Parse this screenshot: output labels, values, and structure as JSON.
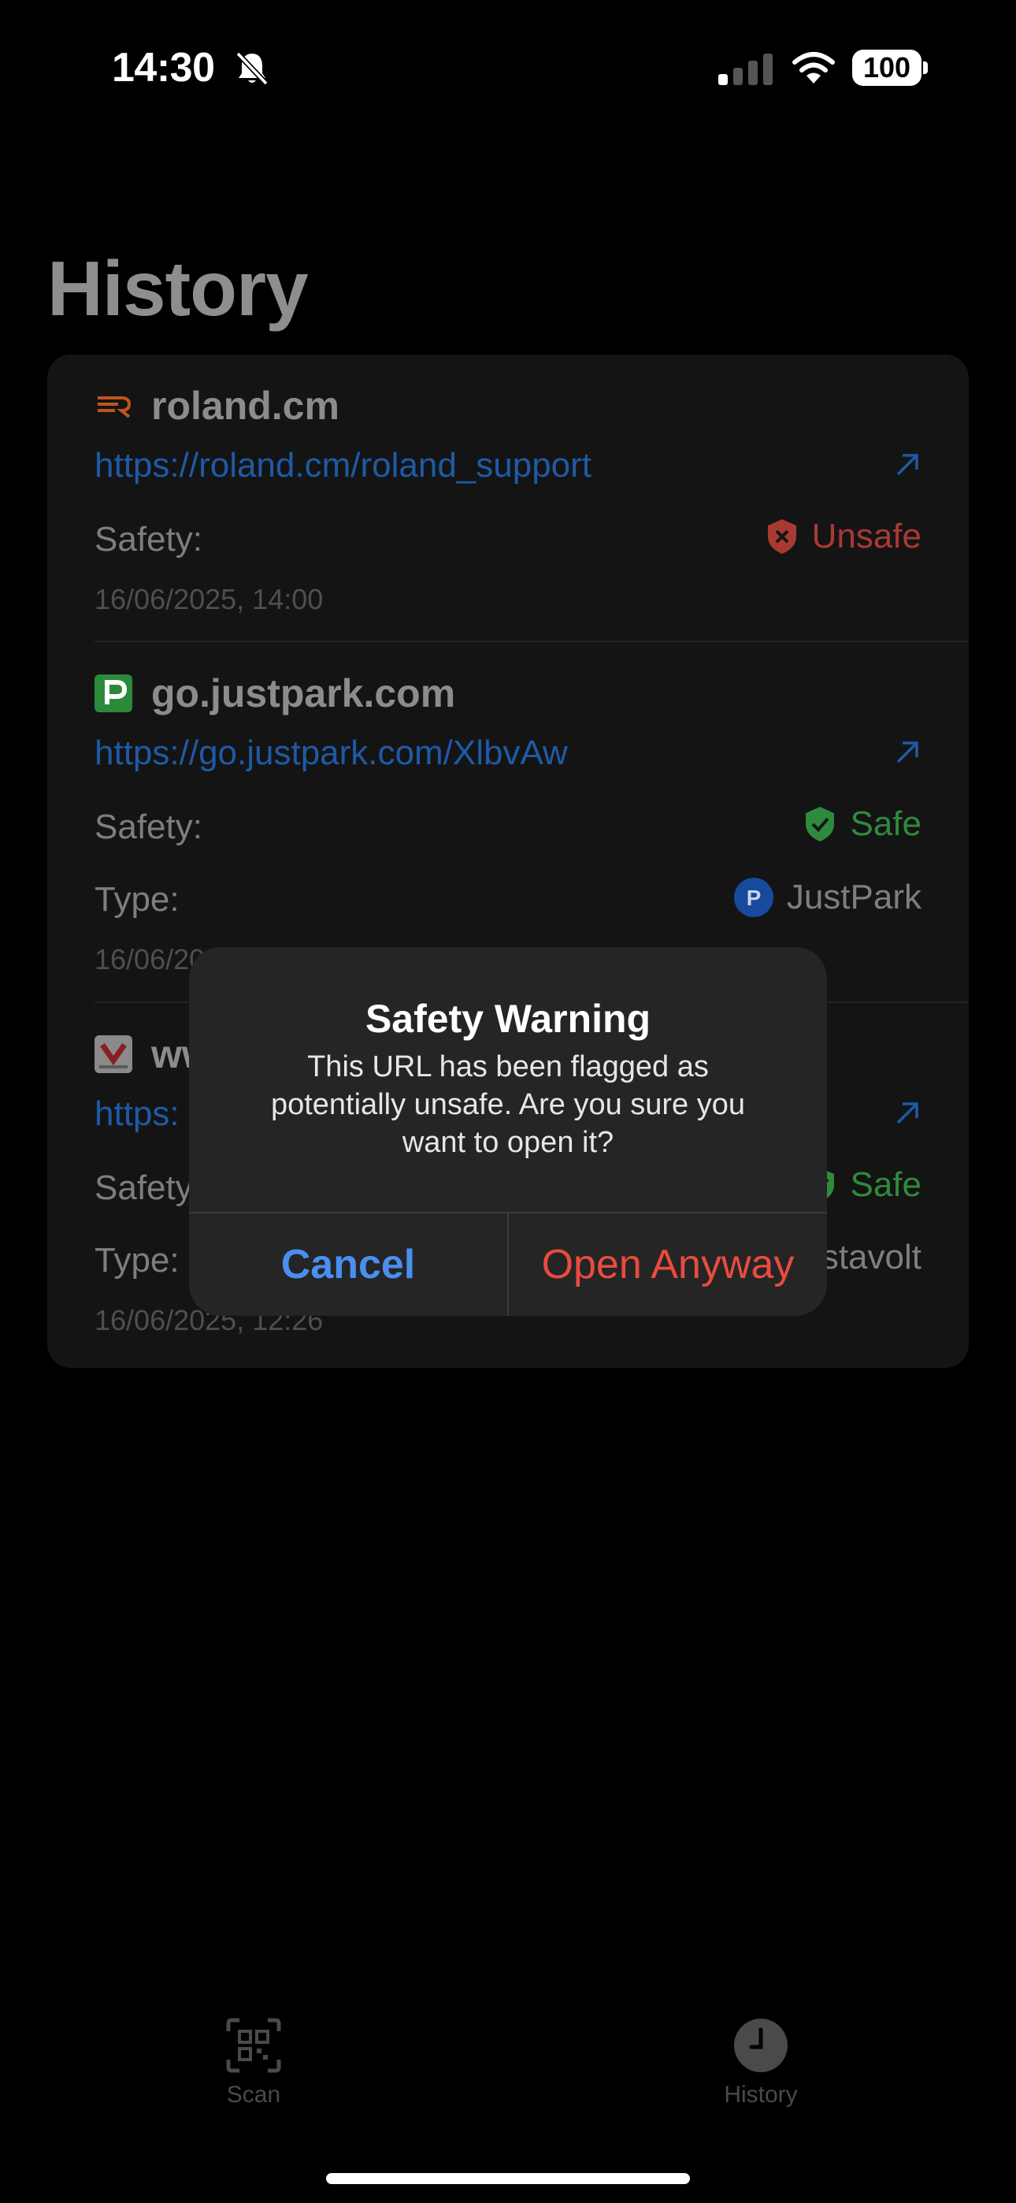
{
  "status_bar": {
    "time": "14:30",
    "battery": "100",
    "icons": [
      "bell-slash-icon",
      "cellular-signal-icon",
      "wifi-icon",
      "battery-icon"
    ]
  },
  "page": {
    "title": "History"
  },
  "history": [
    {
      "domain": "roland.cm",
      "favicon": "roland-logo-icon",
      "url": "https://roland.cm/roland_support",
      "safety_label": "Safety:",
      "safety_value": "Unsafe",
      "safety_icon": "shield-x-icon",
      "date": "16/06/2025, 14:00"
    },
    {
      "domain": "go.justpark.com",
      "favicon": "justpark-logo-icon",
      "url": "https://go.justpark.com/XlbvAw",
      "safety_label": "Safety:",
      "safety_value": "Safe",
      "safety_icon": "shield-check-icon",
      "type_label": "Type:",
      "type_value": "JustPark",
      "date": "16/06/20"
    },
    {
      "domain": "ww",
      "favicon": "vestavolt-logo-icon",
      "url": "https:",
      "safety_label": "Safety",
      "safety_value": "Safe",
      "safety_icon": "shield-check-icon",
      "type_label": "Type:",
      "type_value": "stavolt",
      "date": "16/06/2025, 12:26"
    }
  ],
  "alert": {
    "title": "Safety Warning",
    "message": "This URL has been flagged as potentially unsafe. Are you sure you want to open it?",
    "cancel_label": "Cancel",
    "open_label": "Open Anyway"
  },
  "tabs": [
    {
      "label": "Scan",
      "icon": "qr-code-icon"
    },
    {
      "label": "History",
      "icon": "clock-icon"
    }
  ],
  "colors": {
    "link": "#1e5aa6",
    "unsafe": "#a83a33",
    "safe": "#2f8a3d",
    "cancel": "#4a8ff0",
    "open_anyway": "#ea4b3f"
  }
}
